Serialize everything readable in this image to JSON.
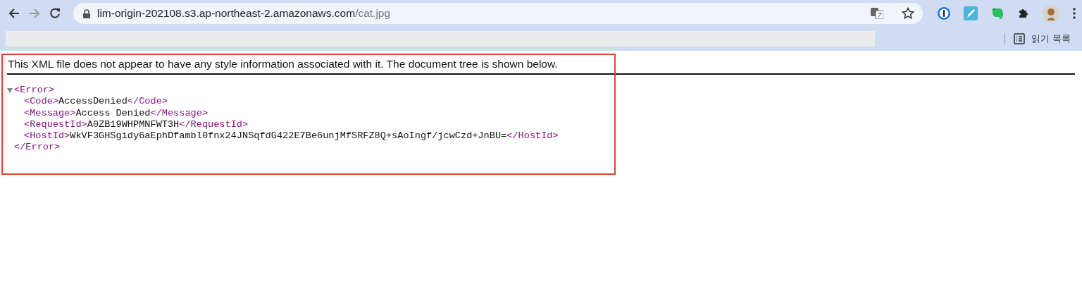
{
  "address_bar": {
    "host": "lim-origin-202108.s3.ap-northeast-2.amazonaws.com",
    "path": "/cat.jpg"
  },
  "bookmarks_bar": {
    "reading_list": "읽기 목록"
  },
  "page": {
    "notice": "This XML file does not appear to have any style information associated with it. The document tree is shown below.",
    "tree": {
      "open": "<Error>",
      "close": "</Error>",
      "expanded": true,
      "children": [
        {
          "open": "<Code>",
          "value": "AccessDenied",
          "close": "</Code>"
        },
        {
          "open": "<Message>",
          "value": "Access Denied",
          "close": "</Message>"
        },
        {
          "open": "<RequestId>",
          "value": "A0ZB19WHPMNFWT3H",
          "close": "</RequestId>"
        },
        {
          "open": "<HostId>",
          "value": "WkVF3GHSgidy6aEphDfambl0fnx24JNSqfdG422E7Be6unjMfSRFZ8Q+sAoIngf/jcwCzd+JnBU=",
          "close": "</HostId>"
        }
      ]
    }
  }
}
